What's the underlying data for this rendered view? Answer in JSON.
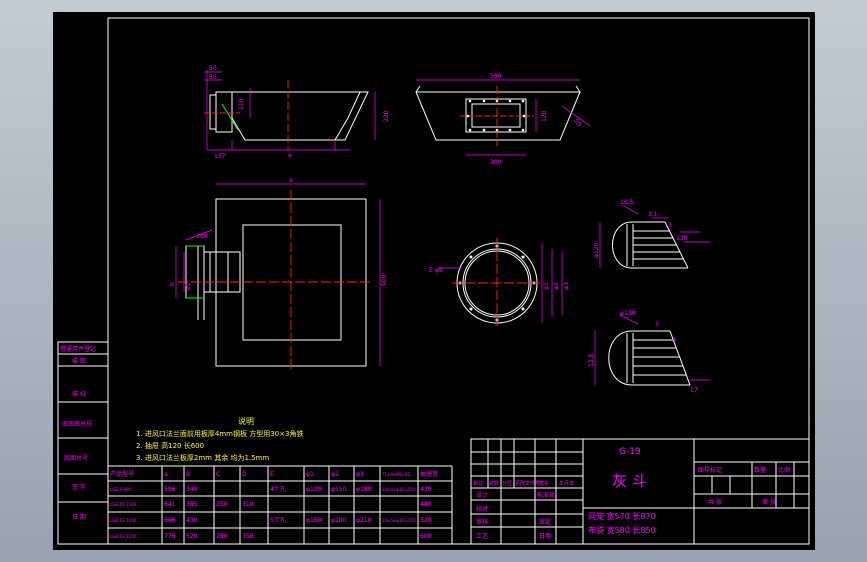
{
  "drawing": {
    "dims": {
      "top_view_left": [
        "50",
        "50",
        "110",
        "137",
        "a",
        "220"
      ],
      "top_view_right": [
        "590",
        "120",
        "50",
        "300"
      ],
      "plan": [
        "a",
        "900",
        "b",
        "b1",
        "100"
      ],
      "circle": [
        "E-φ8",
        "φ1",
        "φ2",
        "φ3"
      ],
      "sections": [
        "10.5",
        "3.1",
        "3",
        "130",
        "φ120",
        "φ130",
        "12.5",
        "3",
        "4",
        "17"
      ]
    },
    "notes": {
      "heading": "说明",
      "lines": [
        "1. 进风口法兰面前用板厚4mm钢板 方型用30×3角铁",
        "2. 抽屉  高120  长600",
        "3. 进风口法兰板厚2mm 其余 均为1.5mm"
      ]
    },
    "left_strip": [
      "借通用件登记",
      "描  图",
      "描  校",
      "旧底图总号",
      "底图总号",
      "签  字",
      "日  期"
    ],
    "param_table": {
      "headers": [
        "产品型号",
        "a",
        "B",
        "C",
        "D",
        "E",
        "φ1",
        "φ2",
        "φ3",
        "T1×d×B1×B2",
        "抽屉宽"
      ],
      "rows": [
        [
          "LGZ-9-800",
          "596",
          "340",
          "",
          "",
          "4个孔",
          "φ120",
          "φ150",
          "φ180",
          "10×4×φ10×250",
          "430"
        ],
        [
          "LGZ-10-1500",
          "641",
          "385",
          "250",
          "310",
          "",
          "",
          "",
          "",
          "",
          "480"
        ],
        [
          "LGZ-11-1000",
          "686",
          "430",
          "",
          "",
          "5个孔",
          "φ150",
          "φ180",
          "φ210",
          "10×5×φ10×310",
          "520"
        ],
        [
          "LGZ-12-2000",
          "776",
          "520",
          "280",
          "350",
          "",
          "",
          "",
          "",
          "",
          "600"
        ]
      ]
    },
    "title_block": {
      "code": "G-19",
      "name": "灰  斗",
      "material_1": "网笼 宽570 长870",
      "material_2": "布袋 宽580 长850",
      "sign_row_headers": [
        "标记",
        "处数",
        "分区",
        "更改文件号",
        "签名",
        "年月日"
      ],
      "sign_labels": [
        "设计",
        "校对",
        "审核",
        "工艺"
      ],
      "sign_labels_2": [
        "标准化",
        "",
        "审定",
        "日期"
      ],
      "stage_headers": [
        "图样标记",
        "数量",
        "比例"
      ],
      "sheet_labels": [
        "共  张",
        "第  张"
      ]
    }
  }
}
